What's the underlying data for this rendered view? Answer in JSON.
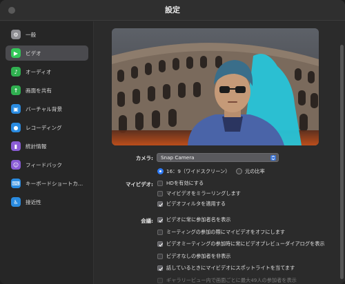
{
  "window": {
    "title": "設定"
  },
  "sidebar": {
    "items": [
      {
        "label": "一般",
        "icon": "gear-icon",
        "color": "#8e8e93"
      },
      {
        "label": "ビデオ",
        "icon": "video-camera-icon",
        "color": "#34c759"
      },
      {
        "label": "オーディオ",
        "icon": "headphones-icon",
        "color": "#30b050"
      },
      {
        "label": "画面を共有",
        "icon": "share-screen-icon",
        "color": "#30b050"
      },
      {
        "label": "バーチャル背景",
        "icon": "virtual-background-icon",
        "color": "#2a8be0"
      },
      {
        "label": "レコーディング",
        "icon": "record-icon",
        "color": "#2a8be0"
      },
      {
        "label": "統計情報",
        "icon": "statistics-icon",
        "color": "#8a5cd6"
      },
      {
        "label": "フィードバック",
        "icon": "feedback-icon",
        "color": "#8a5cd6"
      },
      {
        "label": "キーボードショートカ...",
        "icon": "keyboard-icon",
        "color": "#2a8be0"
      },
      {
        "label": "接近性",
        "icon": "accessibility-icon",
        "color": "#2a8be0"
      }
    ],
    "active_index": 1
  },
  "video": {
    "camera_label": "カメラ:",
    "camera_value": "Snap Camera",
    "ratio_options": [
      {
        "label": "16：9（ワイドスクリーン）",
        "selected": true
      },
      {
        "label": "元の比率",
        "selected": false
      }
    ],
    "my_video_label": "マイビデオ:",
    "my_video_options": [
      {
        "label": "HDを有効にする",
        "checked": false
      },
      {
        "label": "マイビデオをミラーリングします",
        "checked": false
      },
      {
        "label": "ビデオフィルタを適用する",
        "checked": true
      }
    ],
    "meeting_label": "会議:",
    "meeting_options": [
      {
        "label": "ビデオに常に参加者名を表示",
        "checked": true,
        "disabled": false
      },
      {
        "label": "ミーティングの参加の際にマイビデオをオフにします",
        "checked": false,
        "disabled": false
      },
      {
        "label": "ビデオミーティングの参加時に常にビデオプレビューダイアログを表示",
        "checked": true,
        "disabled": false
      },
      {
        "label": "ビデオなしの参加者を非表示",
        "checked": false,
        "disabled": false
      },
      {
        "label": "話しているときにマイビデオにスポットライトを当てます",
        "checked": true,
        "disabled": false
      },
      {
        "label": "ギャラリービュー内で画面ごとに最大49人の参加者を表示",
        "checked": false,
        "disabled": true
      }
    ]
  }
}
